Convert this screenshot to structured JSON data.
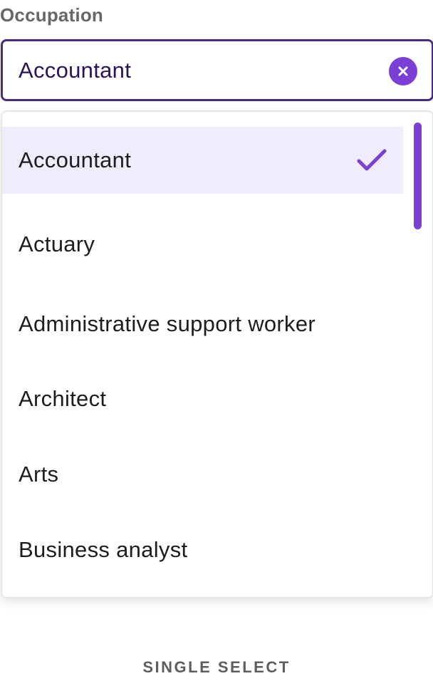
{
  "field": {
    "label": "Occupation",
    "value": "Accountant",
    "clear_icon": "close-icon"
  },
  "dropdown": {
    "selected_index": 0,
    "check_icon": "checkmark-icon",
    "accent_color": "#7b3fd6",
    "selected_bg": "#f0ebfd",
    "options": [
      {
        "label": "Accountant",
        "selected": true
      },
      {
        "label": "Actuary",
        "selected": false
      },
      {
        "label": "Administrative support worker",
        "selected": false
      },
      {
        "label": "Architect",
        "selected": false
      },
      {
        "label": "Arts",
        "selected": false
      },
      {
        "label": "Business analyst",
        "selected": false
      }
    ]
  },
  "footer": {
    "caption": "SINGLE SELECT"
  }
}
